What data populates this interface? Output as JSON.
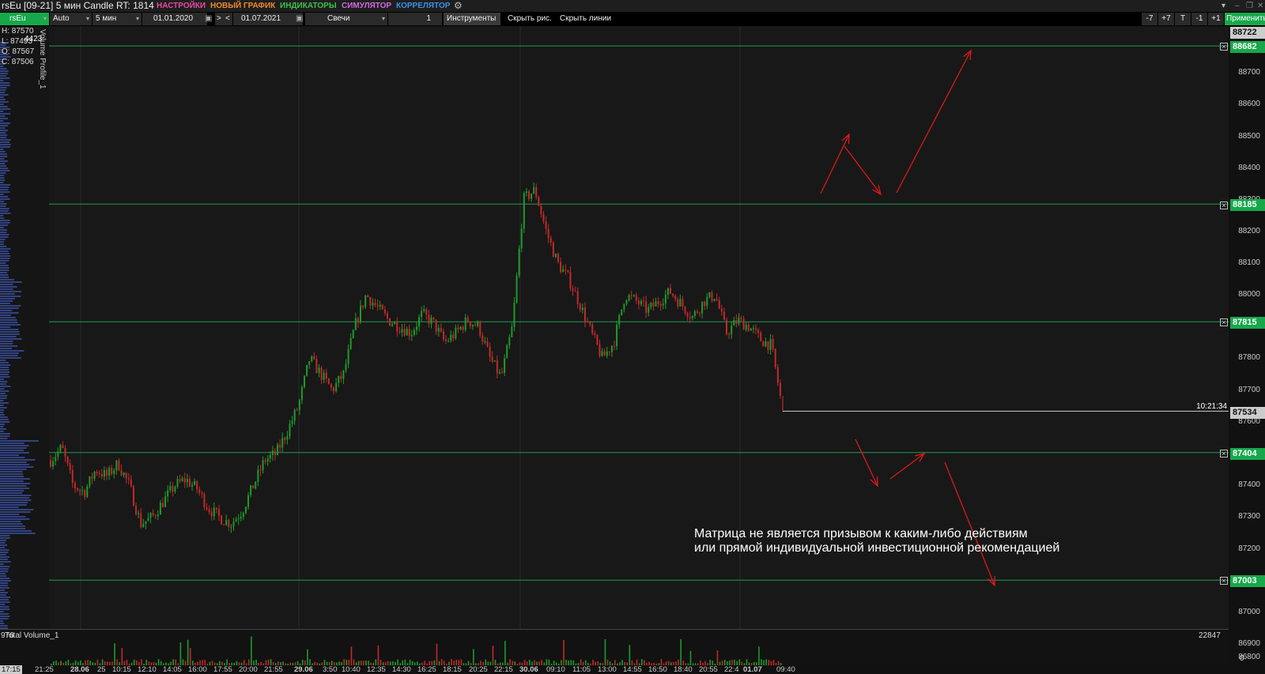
{
  "titlebar": {
    "instrument": "rsEu [09-21] 5 мин Candle RT: 1814",
    "menu": [
      {
        "label": "НАСТРОЙКИ",
        "color": "#e84aa0"
      },
      {
        "label": "НОВЫЙ ГРАФИК",
        "color": "#f08a2c"
      },
      {
        "label": "ИНДИКАТОРЫ",
        "color": "#3cc24a"
      },
      {
        "label": "СИМУЛЯТОР",
        "color": "#d06ae0"
      },
      {
        "label": "КОРРЕЛЯТОР",
        "color": "#3f8fe8"
      }
    ],
    "window_controls": [
      "pin-icon",
      "minimize-icon",
      "restore-icon",
      "close-icon"
    ]
  },
  "toolbar": {
    "symbol": "rsEu",
    "scale": "Auto",
    "timeframe": "5 мин",
    "date_from": "01.01.2020",
    "nav_forward": ">",
    "nav_back": "<",
    "date_to": "01.07.2021",
    "chart_type": "Свечи",
    "step": "1",
    "instruments": "Инструменты",
    "hide_drawings": "Скрыть рис.",
    "hide_lines": "Скрыть линии",
    "shift_buttons": [
      "-7",
      "+7",
      "T",
      "-1",
      "+1"
    ],
    "apply": "Применить"
  },
  "ohlc": {
    "h": "H: 87570",
    "l": "L: 87493",
    "o": "O: 87567",
    "c": "C: 87506",
    "profile_max": "4423"
  },
  "volume_profile_label": "Volume Profile_1",
  "price_axis": {
    "labels": [
      "88700",
      "88600",
      "88500",
      "88400",
      "88300",
      "88200",
      "88100",
      "88000",
      "87900",
      "87800",
      "87700",
      "87600",
      "87500",
      "87400",
      "87300",
      "87200",
      "87100",
      "87000",
      "86900",
      "86800"
    ],
    "top_value": "88722",
    "current_price": "87534",
    "current_time": "10:21:34"
  },
  "levels": [
    "88682",
    "88185",
    "87815",
    "87404",
    "87003"
  ],
  "chart_data": {
    "type": "candlestick",
    "ylim": [
      86800,
      88722
    ],
    "price_series": [
      87380,
      87420,
      87300,
      87280,
      87350,
      87330,
      87370,
      87300,
      87180,
      87200,
      87250,
      87300,
      87320,
      87290,
      87230,
      87200,
      87180,
      87220,
      87300,
      87380,
      87400,
      87470,
      87550,
      87700,
      87650,
      87600,
      87650,
      87800,
      87900,
      87860,
      87820,
      87800,
      87780,
      87840,
      87810,
      87750,
      87780,
      87820,
      87800,
      87700,
      87640,
      87800,
      88200,
      88230,
      88100,
      88000,
      87950,
      87870,
      87780,
      87700,
      87750,
      87900,
      87880,
      87850,
      87880,
      87910,
      87870,
      87830,
      87880,
      87900,
      87780,
      87820,
      87800,
      87760,
      87740,
      87534
    ],
    "volume_max": "22847",
    "volume_min": "0",
    "volume_left_label": "976",
    "volume_title": "Total Volume_1"
  },
  "time_axis": {
    "labels": [
      "17:15",
      "21:25",
      "28.06",
      "25",
      "10:15",
      "12:10",
      "14:05",
      "16:00",
      "17:55",
      "20:00",
      "21:55",
      "29.06",
      "3:50",
      "10:40",
      "12:35",
      "14:30",
      "16:25",
      "18:15",
      "20:25",
      "22:15",
      "30.06",
      "09:10",
      "11:05",
      "13:00",
      "14:55",
      "16:50",
      "18:40",
      "20:55",
      "22:4",
      "01.07",
      "09:40"
    ]
  },
  "disclaimer": {
    "line1": "Матрица не является призывом к каким-либо действиям",
    "line2": "или прямой индивидуальной инвестиционной рекомендацией"
  }
}
